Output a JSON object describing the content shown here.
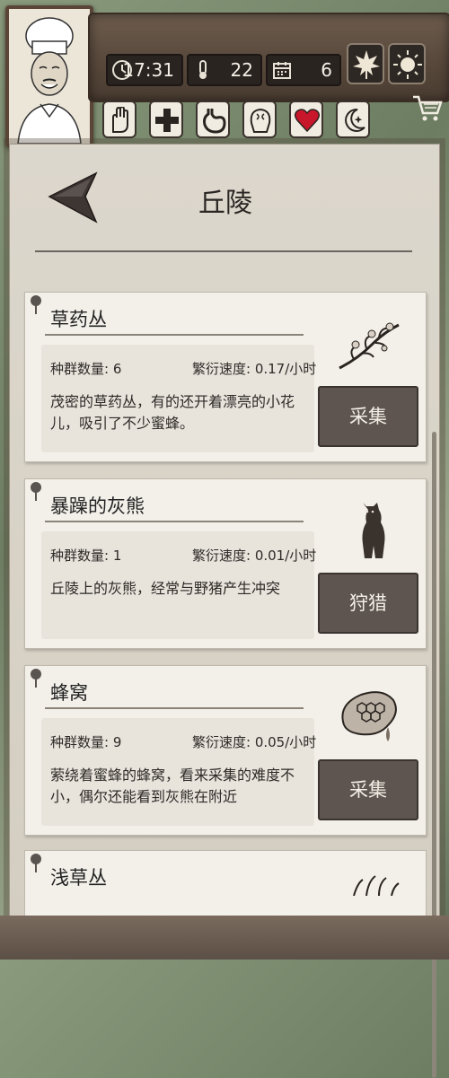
{
  "header": {
    "time": "17:31",
    "temperature": "22",
    "day": "6",
    "icons": {
      "leaf": "leaf-icon",
      "sun": "sun-icon",
      "clock": "clock-icon",
      "thermometer": "thermometer-icon",
      "calendar": "calendar-icon",
      "cart": "cart-icon"
    },
    "actions": [
      "hand-icon",
      "plus-icon",
      "stomach-icon",
      "brain-icon",
      "heart-icon",
      "moon-icon"
    ]
  },
  "page": {
    "title": "丘陵"
  },
  "cards": [
    {
      "name": "草药丛",
      "population": "种群数量: 6",
      "rate": "繁衍速度: 0.17/小时",
      "description": "茂密的草药丛，有的还开着漂亮的小花儿，吸引了不少蜜蜂。",
      "button": "采集",
      "art": "herb-branch-icon"
    },
    {
      "name": "暴躁的灰熊",
      "population": "种群数量: 1",
      "rate": "繁衍速度: 0.01/小时",
      "description": "丘陵上的灰熊，经常与野猪产生冲突",
      "button": "狩猎",
      "art": "bear-icon"
    },
    {
      "name": "蜂窝",
      "population": "种群数量: 9",
      "rate": "繁衍速度: 0.05/小时",
      "description": "萦绕着蜜蜂的蜂窝，看来采集的难度不小，偶尔还能看到灰熊在附近",
      "button": "采集",
      "art": "honeycomb-icon"
    },
    {
      "name": "浅草丛"
    }
  ],
  "colors": {
    "accent_red": "#c8172b",
    "button_bg": "#5e5550",
    "panel_bg": "#dcd7cc"
  }
}
